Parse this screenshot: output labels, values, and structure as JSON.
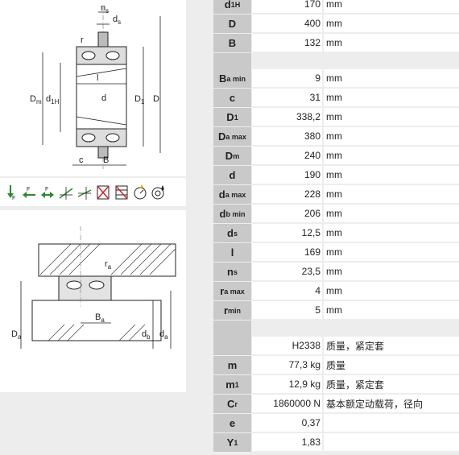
{
  "diagram1": {
    "labels": {
      "ns": "n",
      "ns_sub": "s",
      "ds": "d",
      "ds_sub": "s",
      "r": "r",
      "Dm": "D",
      "Dm_sub": "m",
      "d1H": "d",
      "d1H_sub": "1H",
      "l": "l",
      "d": "d",
      "D1": "D",
      "D1_sub": "1",
      "D": "D",
      "c": "c",
      "B": "B"
    }
  },
  "icons": [
    {
      "name": "radial-load-icon",
      "label": "F",
      "sub": "r"
    },
    {
      "name": "axial-load-left-icon",
      "label": "F",
      "sub": "a"
    },
    {
      "name": "axial-load-both-icon",
      "label": "F",
      "sub": "a"
    },
    {
      "name": "misalignment-icon"
    },
    {
      "name": "angular-misalignment-icon"
    },
    {
      "name": "no-rigid-icon"
    },
    {
      "name": "sealing-icon"
    },
    {
      "name": "speed-icon"
    },
    {
      "name": "lubrication-icon"
    }
  ],
  "diagram2": {
    "labels": {
      "ra": "r",
      "ra_sub": "a",
      "Da": "D",
      "Da_sub": "a",
      "Ba": "B",
      "Ba_sub": "a",
      "db": "d",
      "db_sub": "b",
      "da": "d",
      "da_sub": "a"
    }
  },
  "table": {
    "group1": [
      {
        "sym": "d",
        "sub": "1H",
        "value": "170",
        "unit": "mm"
      },
      {
        "sym": "D",
        "sub": "",
        "value": "400",
        "unit": "mm"
      },
      {
        "sym": "B",
        "sub": "",
        "value": "132",
        "unit": "mm"
      }
    ],
    "group2": [
      {
        "sym": "B",
        "sub": "a min",
        "value": "9",
        "unit": "mm"
      },
      {
        "sym": "c",
        "sub": "",
        "value": "31",
        "unit": "mm"
      },
      {
        "sym": "D",
        "sub": "1",
        "value": "338,2",
        "unit": "mm"
      },
      {
        "sym": "D",
        "sub": "a max",
        "value": "380",
        "unit": "mm"
      },
      {
        "sym": "D",
        "sub": "m",
        "value": "240",
        "unit": "mm"
      },
      {
        "sym": "d",
        "sub": "",
        "value": "190",
        "unit": "mm"
      },
      {
        "sym": "d",
        "sub": "a max",
        "value": "228",
        "unit": "mm"
      },
      {
        "sym": "d",
        "sub": "b min",
        "value": "206",
        "unit": "mm"
      },
      {
        "sym": "d",
        "sub": "s",
        "value": "12,5",
        "unit": "mm"
      },
      {
        "sym": "l",
        "sub": "",
        "value": "169",
        "unit": "mm"
      },
      {
        "sym": "n",
        "sub": "s",
        "value": "23,5",
        "unit": "mm"
      },
      {
        "sym": "r",
        "sub": "a max",
        "value": "4",
        "unit": "mm"
      },
      {
        "sym": "r",
        "sub": "min",
        "value": "5",
        "unit": "mm"
      }
    ],
    "group3": [
      {
        "sym": "",
        "sub": "",
        "value": "H2338",
        "unit": "质量，紧定套"
      },
      {
        "sym": "m",
        "sub": "",
        "value": "77,3  kg",
        "unit": "质量"
      },
      {
        "sym": "m",
        "sub": "1",
        "value": "12,9  kg",
        "unit": "质量，紧定套"
      },
      {
        "sym": "C",
        "sub": "r",
        "value": "1860000  N",
        "unit": "基本额定动载荷，径向"
      },
      {
        "sym": "e",
        "sub": "",
        "value": "0,37",
        "unit": ""
      },
      {
        "sym": "Y",
        "sub": "1",
        "value": "1,83",
        "unit": ""
      }
    ]
  }
}
